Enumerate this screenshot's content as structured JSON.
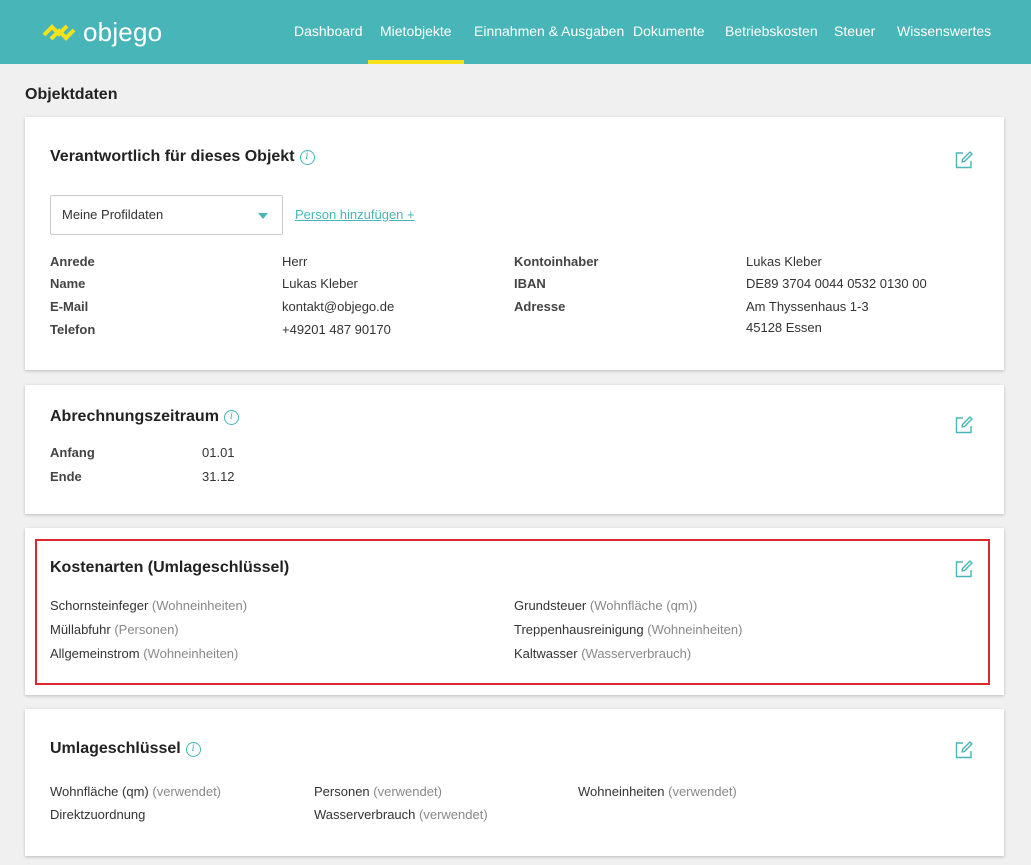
{
  "brand": {
    "name": "objego",
    "accent": "#48b5b8",
    "highlight": "#f7e11b",
    "logo_color": "#f7e11b"
  },
  "nav": {
    "items": [
      {
        "label": "Dashboard"
      },
      {
        "label": "Mietobjekte",
        "active": true
      },
      {
        "label": "Einnahmen & Ausgaben"
      },
      {
        "label": "Dokumente"
      },
      {
        "label": "Betriebskosten"
      },
      {
        "label": "Steuer"
      },
      {
        "label": "Wissenswertes"
      }
    ]
  },
  "page": {
    "title": "Objektdaten"
  },
  "responsible": {
    "title": "Verantwortlich für dieses Objekt",
    "select_value": "Meine Profildaten",
    "add_person": "Person hinzufügen +",
    "left": [
      {
        "label": "Anrede",
        "value": "Herr"
      },
      {
        "label": "Name",
        "value": "Lukas Kleber"
      },
      {
        "label": "E-Mail",
        "value": "kontakt@objego.de"
      },
      {
        "label": "Telefon",
        "value": "+49201 487 90170"
      }
    ],
    "right": [
      {
        "label": "Kontoinhaber",
        "value": "Lukas Kleber"
      },
      {
        "label": "IBAN",
        "value": "DE89 3704 0044 0532 0130 00"
      },
      {
        "label": "Adresse",
        "value": "Am Thyssenhaus 1-3",
        "value2": "45128 Essen"
      }
    ]
  },
  "billing_period": {
    "title": "Abrechnungszeitraum",
    "rows": [
      {
        "label": "Anfang",
        "value": "01.01"
      },
      {
        "label": "Ende",
        "value": "31.12"
      }
    ]
  },
  "cost_types": {
    "title": "Kostenarten (Umlageschlüssel)",
    "items": [
      {
        "name": "Schornsteinfeger",
        "key": "(Wohneinheiten)"
      },
      {
        "name": "Müllabfuhr",
        "key": "(Personen)"
      },
      {
        "name": "Allgemeinstrom",
        "key": "(Wohneinheiten)"
      },
      {
        "name": "Grundsteuer",
        "key": "(Wohnfläche (qm))"
      },
      {
        "name": "Treppenhausreinigung",
        "key": "(Wohneinheiten)"
      },
      {
        "name": "Kaltwasser",
        "key": "(Wasserverbrauch)"
      }
    ]
  },
  "allocation_keys": {
    "title": "Umlageschlüssel",
    "items": [
      {
        "name": "Wohnfläche (qm)",
        "note": "(verwendet)"
      },
      {
        "name": "Direktzuordnung",
        "note": ""
      },
      {
        "name": "Personen",
        "note": "(verwendet)"
      },
      {
        "name": "Wasserverbrauch",
        "note": "(verwendet)"
      },
      {
        "name": "Wohneinheiten",
        "note": "(verwendet)"
      }
    ]
  },
  "icons": {
    "info": "info-icon",
    "edit": "edit-icon"
  }
}
